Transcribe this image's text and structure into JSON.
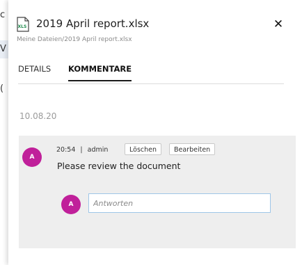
{
  "panel": {
    "file_name": "2019 April report.xlsx",
    "file_type_label": "XLS",
    "path": "Meine Dateien/2019 April report.xlsx",
    "close_symbol": "✕",
    "icons": {
      "file": "excel-file-icon",
      "close": "close-icon"
    },
    "colors": {
      "file_icon": "#1e8a4c",
      "avatar": "#c0209a",
      "input_border": "#9ec6e8"
    }
  },
  "tabs": [
    {
      "label": "DETAILS",
      "active": false
    },
    {
      "label": "KOMMENTARE",
      "active": true
    }
  ],
  "comments": {
    "date": "10.08.20",
    "items": [
      {
        "avatar_initial": "A",
        "time": "20:54",
        "separator": "|",
        "author": "admin",
        "delete_label": "Löschen",
        "edit_label": "Bearbeiten",
        "text": "Please review the document"
      }
    ],
    "reply": {
      "avatar_initial": "A",
      "placeholder": "Antworten",
      "value": ""
    }
  }
}
